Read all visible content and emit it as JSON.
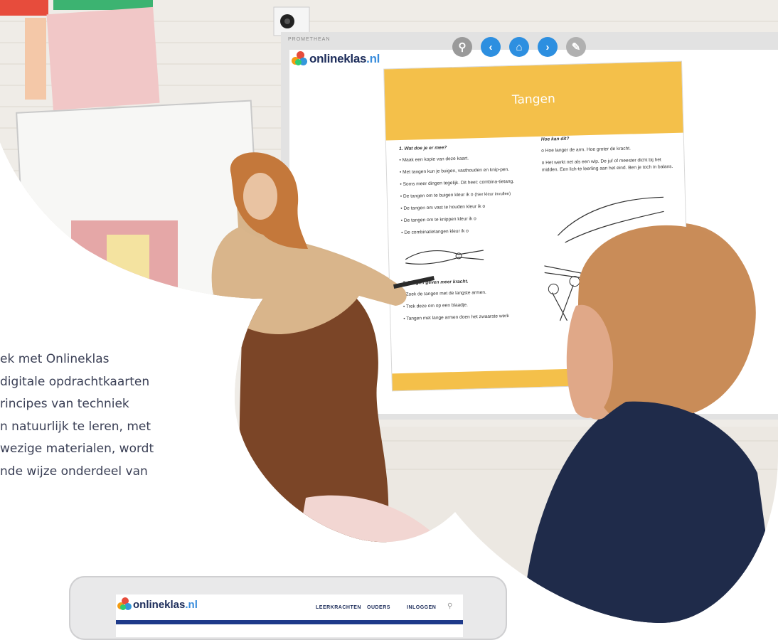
{
  "intro": {
    "lines": [
      "ek met Onlineklas",
      "digitale opdrachtkaarten",
      "rincipes van techniek",
      "n natuurlijk te leren, met",
      "wezige materialen, wordt",
      "nde wijze onderdeel van"
    ]
  },
  "board": {
    "brand": "PROMETHEAN"
  },
  "app": {
    "logo_name": "onlineklas",
    "logo_tld": ".nl",
    "toolbar": [
      {
        "icon": "search-icon",
        "glyph": "⚲",
        "color": "#9a9a9a"
      },
      {
        "icon": "chevron-left-icon",
        "glyph": "‹",
        "color": "#2d8fe0"
      },
      {
        "icon": "home-icon",
        "glyph": "⌂",
        "color": "#2d8fe0"
      },
      {
        "icon": "chevron-right-icon",
        "glyph": "›",
        "color": "#2d8fe0"
      },
      {
        "icon": "pencil-icon",
        "glyph": "✎",
        "color": "#b0b0b0"
      }
    ]
  },
  "sheet": {
    "title": "Tangen",
    "left_heading": "1. Wat doe je er mee?",
    "left_items": [
      "Maak een kopie van deze kaart.",
      "Met tangen kun je buigen, vasthouden en knip-pen.",
      "Soms meer dingen tegelijk. Dit heet: combina-tietang.",
      "De tangen om te buigen kleur ik",
      "De tangen om vast te houden kleur ik",
      "De tangen om te knippen kleur ik",
      "De combinatietangen kleur ik"
    ],
    "hint": "(hier kleur invullen)",
    "left_heading2": "2. Tangen geven meer kracht.",
    "left_items2": [
      "Zoek de tangen met de langste armen.",
      "Trek deze om op een blaadje.",
      "Tangen met lange armen doen het zwaarste werk"
    ],
    "right_heading": "Hoe kan dit?",
    "right_items": [
      "Hoe langer de arm. Hoe groter de kracht.",
      "Het werkt net als een wip. De juf of meester dicht bij het midden. Een lich-te leerling aan het eind. Ben je toch in balans."
    ]
  },
  "tablet": {
    "logo_name": "onlineklas",
    "logo_tld": ".nl",
    "nav": [
      "LEERKRACHTEN",
      "OUDERS",
      "INLOGGEN"
    ]
  },
  "colors": {
    "accent_yellow": "#f4c04a",
    "brand_blue": "#1c2c5a",
    "button_blue": "#2d8fe0"
  }
}
